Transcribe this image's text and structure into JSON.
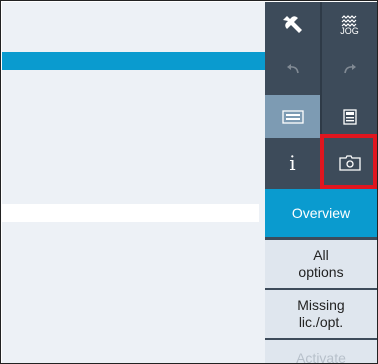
{
  "toolbar": {
    "jog_label": "JOG",
    "info_label": "i"
  },
  "menu": {
    "overview": "Overview",
    "all_options_1": "All",
    "all_options_2": "options",
    "missing_1": "Missing",
    "missing_2": "lic./opt.",
    "activate": "Activate"
  },
  "colors": {
    "accent": "#0a9bcf",
    "toolbar_bg": "#3d4b5a",
    "toolbar_active": "#7d9bb3",
    "highlight": "#e0161f"
  }
}
